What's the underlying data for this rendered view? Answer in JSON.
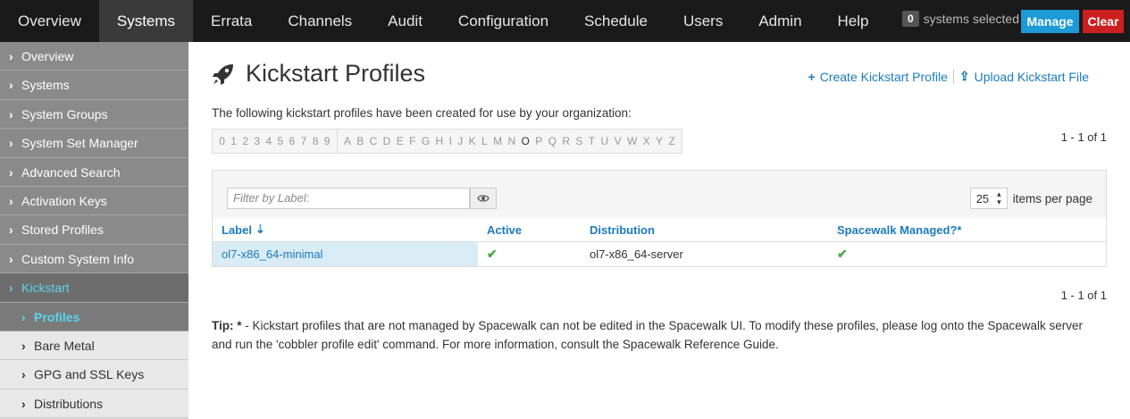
{
  "topnav": {
    "items": [
      "Overview",
      "Systems",
      "Errata",
      "Channels",
      "Audit",
      "Configuration",
      "Schedule",
      "Users",
      "Admin",
      "Help"
    ],
    "active": "Systems",
    "systems_count": "0",
    "systems_selected_label": "systems selected",
    "manage_label": "Manage",
    "clear_label": "Clear"
  },
  "sidebar": {
    "items": [
      {
        "label": "Overview"
      },
      {
        "label": "Systems"
      },
      {
        "label": "System Groups"
      },
      {
        "label": "System Set Manager"
      },
      {
        "label": "Advanced Search"
      },
      {
        "label": "Activation Keys"
      },
      {
        "label": "Stored Profiles"
      },
      {
        "label": "Custom System Info"
      },
      {
        "label": "Kickstart"
      },
      {
        "label": "Profiles"
      },
      {
        "label": "Bare Metal"
      },
      {
        "label": "GPG and SSL Keys"
      },
      {
        "label": "Distributions"
      }
    ]
  },
  "page": {
    "title": "Kickstart Profiles",
    "create_label": "Create Kickstart Profile",
    "upload_label": "Upload Kickstart File",
    "intro": "The following kickstart profiles have been created for use by your organization:",
    "digits": [
      "0",
      "1",
      "2",
      "3",
      "4",
      "5",
      "6",
      "7",
      "8",
      "9"
    ],
    "letters": [
      "A",
      "B",
      "C",
      "D",
      "E",
      "F",
      "G",
      "H",
      "I",
      "J",
      "K",
      "L",
      "M",
      "N",
      "O",
      "P",
      "Q",
      "R",
      "S",
      "T",
      "U",
      "V",
      "W",
      "X",
      "Y",
      "Z"
    ],
    "active_letter": "O",
    "pager": "1 - 1 of 1",
    "filter_placeholder": "Filter by Label:",
    "items_per_page_value": "25",
    "items_per_page_label": "items per page",
    "columns": [
      "Label",
      "Active",
      "Distribution",
      "Spacewalk Managed?*"
    ],
    "rows": [
      {
        "label": "ol7-x86_64-minimal",
        "active": "✔",
        "distribution": "ol7-x86_64-server",
        "managed": "✔"
      }
    ],
    "tip_prefix": "Tip: * ",
    "tip_text": "- Kickstart profiles that are not managed by Spacewalk can not be edited in the Spacewalk UI. To modify these profiles, please log onto the Spacewalk server and run the 'cobbler profile edit' command. For more information, consult the Spacewalk Reference Guide."
  }
}
